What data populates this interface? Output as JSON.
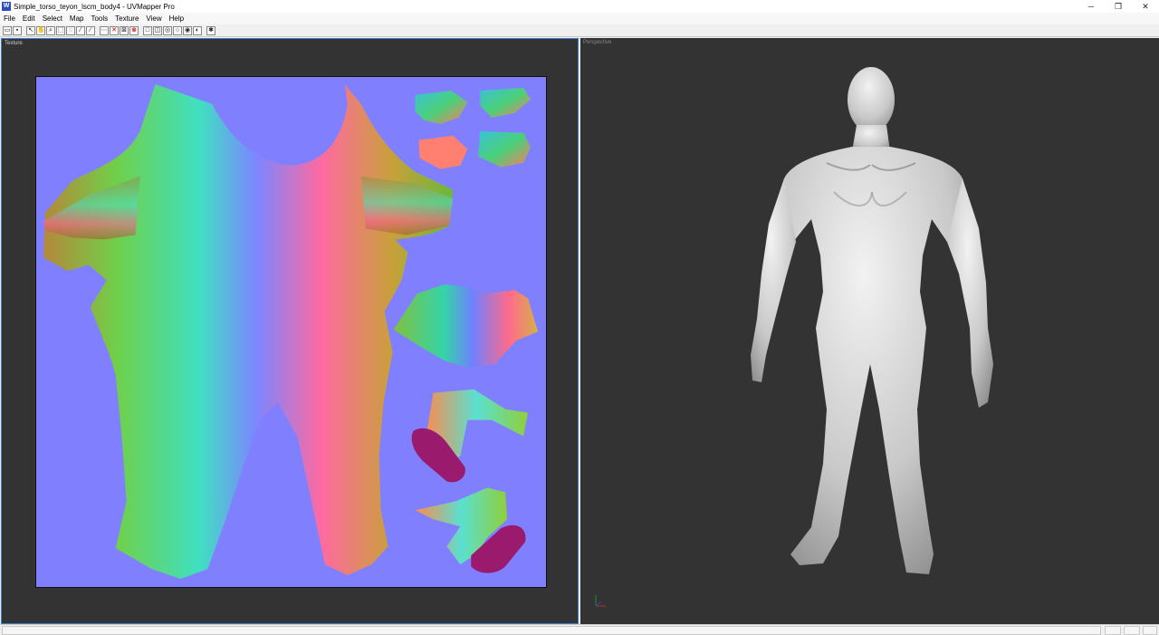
{
  "window": {
    "title": "Simple_torso_teyon_lscm_body4 - UVMapper Pro",
    "icon_letter": "W",
    "minimize": "─",
    "restore": "❐",
    "close": "✕"
  },
  "menu": [
    "File",
    "Edit",
    "Select",
    "Map",
    "Tools",
    "Texture",
    "View",
    "Help"
  ],
  "toolbar_icons": [
    "open-icon",
    "save-icon",
    "select-arrow-icon",
    "hand-pan-icon",
    "zoom-icon",
    "marquee-select-icon",
    "lasso-select-icon",
    "magic-wand-icon",
    "brush-icon",
    "vertex-select-icon",
    "delete-icon",
    "delete-facets-icon",
    "clear-icon",
    "box-map-icon",
    "cube-map-icon",
    "cylinder-map-icon",
    "sphere-map-icon",
    "planar-map-icon",
    "lscm-icon",
    "settings-icon"
  ],
  "panels": {
    "left_label": "Texture",
    "right_label": "Perspective"
  },
  "colors": {
    "uv_background": "#8080ff",
    "viewport_bg": "#333333",
    "active_border": "#3a7bd5"
  }
}
